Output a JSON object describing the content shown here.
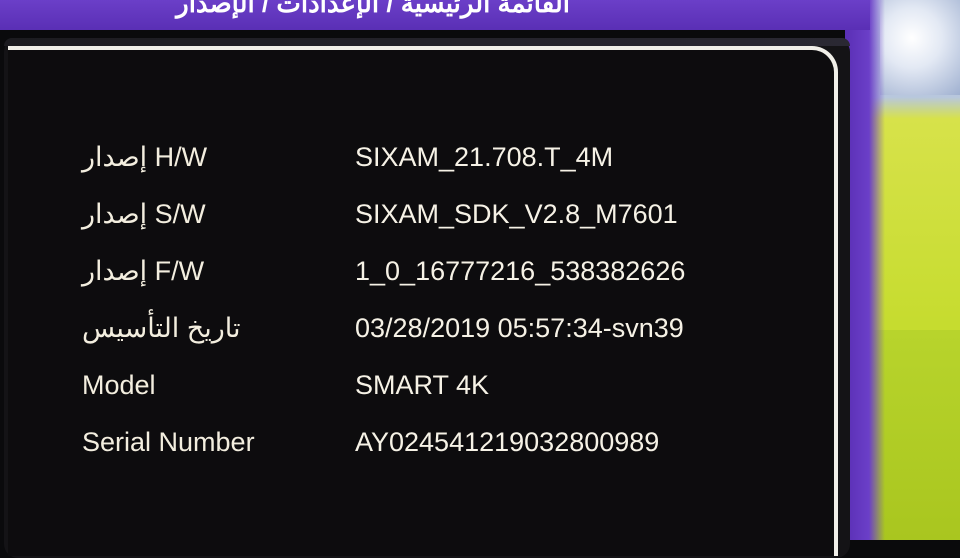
{
  "header": {
    "title": "القائمة الرئيسية / الإعدادات / الإصدار"
  },
  "info_rows": [
    {
      "label": "إصدار H/W",
      "value": "SIXAM_21.708.T_4M"
    },
    {
      "label": "إصدار S/W",
      "value": "SIXAM_SDK_V2.8_M7601"
    },
    {
      "label": "إصدار F/W",
      "value": "1_0_16777216_538382626"
    },
    {
      "label": "تاريخ التأسيس",
      "value": "03/28/2019 05:57:34-svn39"
    },
    {
      "label": "Model",
      "value": "SMART 4K"
    },
    {
      "label": "Serial Number",
      "value": "AY024541219032800989"
    }
  ],
  "colors": {
    "header_purple": "#6b3fc8",
    "panel_background": "#0d0c0e",
    "text": "#f3eedf",
    "panel_border": "#f1efe9"
  }
}
